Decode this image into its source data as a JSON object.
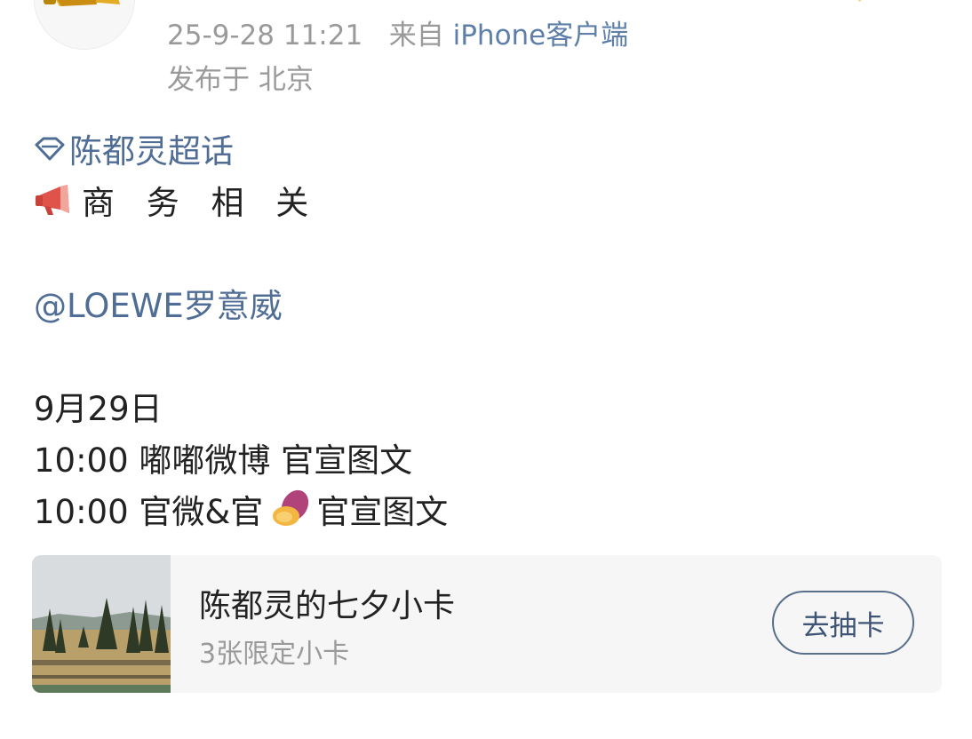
{
  "post": {
    "time": "25-9-28 11:21",
    "source_prefix": "来自",
    "source": "iPhone客户端",
    "location": "发布于 北京",
    "supertopic": "陈都灵超话",
    "business": "商 务 相 关",
    "mention": "@LOEWE罗意威",
    "date": "9月29日",
    "schedule_1": "10:00 嘟嘟微博 官宣图文",
    "schedule_2_prefix": "10:00 官微&官",
    "schedule_2_suffix": "官宣图文"
  },
  "card": {
    "title": "陈都灵的七夕小卡",
    "subtitle": "3张限定小卡",
    "button_label": "去抽卡"
  },
  "icons": {
    "avatar": "megaphone-avatar",
    "supertopic": "diamond-icon",
    "business": "megaphone-icon",
    "sweet_potato": "sweet-potato-icon"
  },
  "colors": {
    "link": "#4f6d95",
    "meta_gray": "#9a9a9a",
    "card_bg": "#f6f6f6"
  }
}
